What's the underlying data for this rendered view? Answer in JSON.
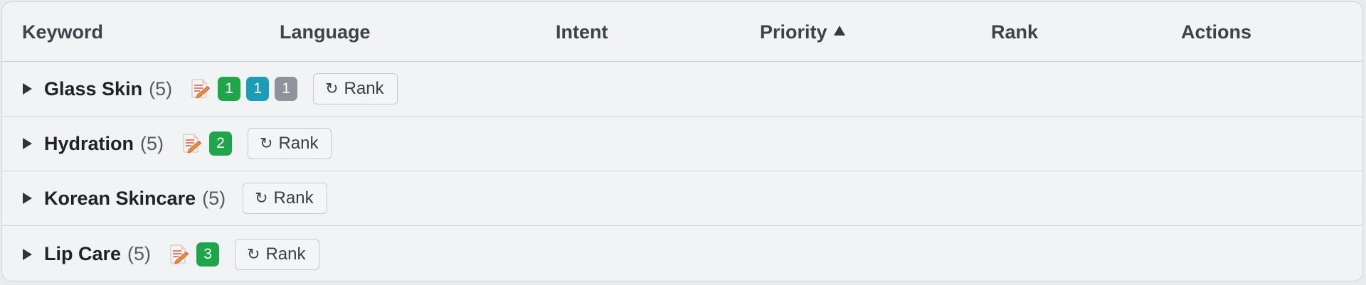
{
  "table": {
    "headers": {
      "keyword": "Keyword",
      "language": "Language",
      "intent": "Intent",
      "priority": "Priority",
      "rank": "Rank",
      "actions": "Actions"
    },
    "sort": {
      "column": "Priority",
      "direction": "ascending",
      "icon": "sort-up-icon"
    },
    "groups": [
      {
        "name": "Glass Skin",
        "count": "(5)",
        "has_note_icon": true,
        "badges": [
          {
            "value": "1",
            "color": "#1fa64a"
          },
          {
            "value": "1",
            "color": "#1b9db5"
          },
          {
            "value": "1",
            "color": "#8e949a"
          }
        ],
        "rank_button": "Rank"
      },
      {
        "name": "Hydration",
        "count": "(5)",
        "has_note_icon": true,
        "badges": [
          {
            "value": "2",
            "color": "#1fa64a"
          }
        ],
        "rank_button": "Rank"
      },
      {
        "name": "Korean Skincare",
        "count": "(5)",
        "has_note_icon": false,
        "badges": [],
        "rank_button": "Rank"
      },
      {
        "name": "Lip Care",
        "count": "(5)",
        "has_note_icon": true,
        "badges": [
          {
            "value": "3",
            "color": "#1fa64a"
          }
        ],
        "rank_button": "Rank"
      }
    ]
  },
  "icons": {
    "expand": "caret-right-icon",
    "note": "memo-icon",
    "refresh": "refresh-icon",
    "refresh_glyph": "↻"
  }
}
